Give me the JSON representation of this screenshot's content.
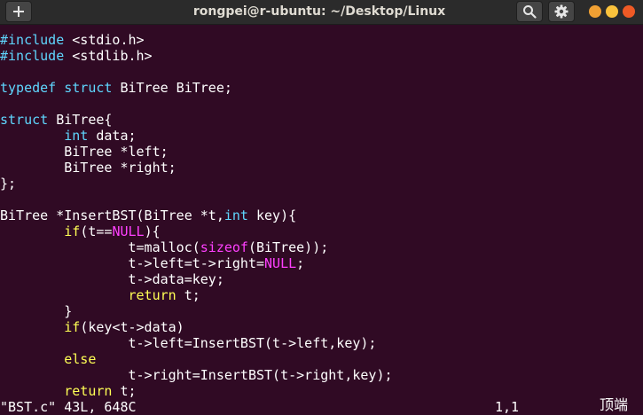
{
  "window": {
    "title": "rongpei@r-ubuntu: ~/Desktop/Linux"
  },
  "header_buttons": {
    "new_tab_icon": "plus-icon",
    "search_icon": "search-icon",
    "menu_icon": "gear-icon"
  },
  "colors": {
    "background": "#300a24",
    "foreground": "#ffffff",
    "preprocessor": "#5fd7ff",
    "type": "#5fd7ff",
    "statement": "#ffff55",
    "constant": "#ff40ff",
    "close": "#ef5a25",
    "minimize": "#f0a033",
    "maximize": "#fac23c"
  },
  "code_lines": [
    [
      [
        "pre",
        "#include"
      ],
      [
        "txt",
        " <stdio.h>"
      ]
    ],
    [
      [
        "pre",
        "#include"
      ],
      [
        "txt",
        " <stdlib.h>"
      ]
    ],
    [],
    [
      [
        "typ",
        "typedef"
      ],
      [
        "txt",
        " "
      ],
      [
        "typ",
        "struct"
      ],
      [
        "txt",
        " BiTree BiTree;"
      ]
    ],
    [],
    [
      [
        "typ",
        "struct"
      ],
      [
        "txt",
        " BiTree{"
      ]
    ],
    [
      [
        "txt",
        "        "
      ],
      [
        "typ",
        "int"
      ],
      [
        "txt",
        " data;"
      ]
    ],
    [
      [
        "txt",
        "        BiTree *left;"
      ]
    ],
    [
      [
        "txt",
        "        BiTree *right;"
      ]
    ],
    [
      [
        "txt",
        "};"
      ]
    ],
    [],
    [
      [
        "txt",
        "BiTree *InsertBST(BiTree *t,"
      ],
      [
        "typ",
        "int"
      ],
      [
        "txt",
        " key){"
      ]
    ],
    [
      [
        "txt",
        "        "
      ],
      [
        "stm",
        "if"
      ],
      [
        "txt",
        "(t=="
      ],
      [
        "con",
        "NULL"
      ],
      [
        "txt",
        "){"
      ]
    ],
    [
      [
        "txt",
        "                t=malloc("
      ],
      [
        "con",
        "sizeof"
      ],
      [
        "txt",
        "(BiTree));"
      ]
    ],
    [
      [
        "txt",
        "                t->left=t->right="
      ],
      [
        "con",
        "NULL"
      ],
      [
        "txt",
        ";"
      ]
    ],
    [
      [
        "txt",
        "                t->data=key;"
      ]
    ],
    [
      [
        "txt",
        "                "
      ],
      [
        "stm",
        "return"
      ],
      [
        "txt",
        " t;"
      ]
    ],
    [
      [
        "txt",
        "        }"
      ]
    ],
    [
      [
        "txt",
        "        "
      ],
      [
        "stm",
        "if"
      ],
      [
        "txt",
        "(key<t->data)"
      ]
    ],
    [
      [
        "txt",
        "                t->left=InsertBST(t->left,key);"
      ]
    ],
    [
      [
        "txt",
        "        "
      ],
      [
        "stm",
        "else"
      ]
    ],
    [
      [
        "txt",
        "                t->right=InsertBST(t->right,key);"
      ]
    ],
    [
      [
        "txt",
        "        "
      ],
      [
        "stm",
        "return"
      ],
      [
        "txt",
        " t;"
      ]
    ]
  ],
  "status_bar": {
    "file_info": "\"BST.c\" 43L, 648C",
    "cursor_position": "1,1",
    "scroll_position": "顶端"
  }
}
